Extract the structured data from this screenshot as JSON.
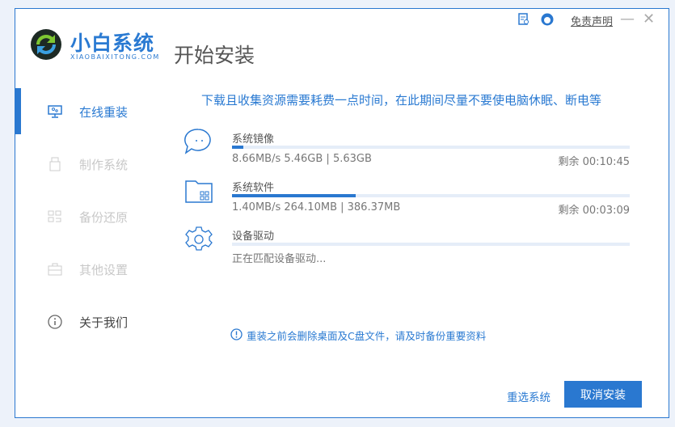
{
  "app": {
    "logo_text": "小白系统",
    "logo_sub": "XIAOBAIXITONG.COM",
    "page_title": "开始安装"
  },
  "topbar": {
    "disclaimer": "免责声明",
    "minimize": "—",
    "close": "✕"
  },
  "sidebar": {
    "items": [
      {
        "label": "在线重装",
        "icon": "monitor-icon",
        "active": true
      },
      {
        "label": "制作系统",
        "icon": "usb-icon",
        "active": false
      },
      {
        "label": "备份还原",
        "icon": "backup-icon",
        "active": false
      },
      {
        "label": "其他设置",
        "icon": "briefcase-icon",
        "active": false
      },
      {
        "label": "关于我们",
        "icon": "info-icon",
        "active": false
      }
    ]
  },
  "main": {
    "notice": "下载且收集资源需要耗费一点时间，在此期间尽量不要使电脑休眠、断电等",
    "tasks": [
      {
        "name": "系统镜像",
        "icon": "chat-bubble-icon",
        "progress": 0.028,
        "detail": "8.66MB/s 5.46GB | 5.63GB",
        "remaining": "剩余 00:10:45"
      },
      {
        "name": "系统软件",
        "icon": "folder-apps-icon",
        "progress": 0.31,
        "detail": "1.40MB/s 264.10MB | 386.37MB",
        "remaining": "剩余 00:03:09"
      },
      {
        "name": "设备驱动",
        "icon": "gear-icon",
        "progress": 0,
        "detail": "正在匹配设备驱动...",
        "remaining": ""
      }
    ],
    "warning": "重装之前会删除桌面及C盘文件，请及时备份重要资料",
    "reselect_label": "重选系统",
    "cancel_label": "取消安装"
  },
  "colors": {
    "accent": "#2a78d0",
    "inactive": "#c8c8c8",
    "text": "#555555"
  }
}
